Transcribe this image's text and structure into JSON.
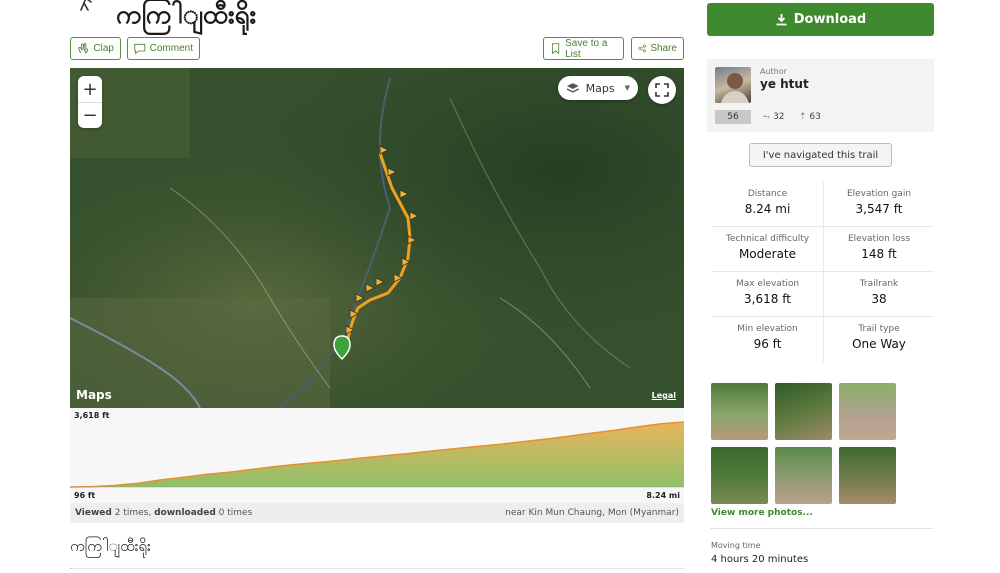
{
  "page": {
    "title": "ကကြါျထီးရိုး",
    "subtitle": "ကကြါျထီးရိုး"
  },
  "actions": {
    "clap": "Clap",
    "comment": "Comment",
    "save": "Save to a List",
    "share": "Share"
  },
  "map": {
    "layer_label": "Maps",
    "zoom_in": "+",
    "zoom_out": "−",
    "logo": "Maps",
    "legal": "Legal"
  },
  "elevation": {
    "max": "3,618 ft",
    "min": "96 ft",
    "distance": "8.24 mi",
    "profile": [
      96,
      120,
      180,
      300,
      480,
      620,
      780,
      900,
      1050,
      1200,
      1330,
      1440,
      1560,
      1690,
      1810,
      1930,
      2060,
      2180,
      2300,
      2420,
      2560,
      2700,
      2860,
      3020,
      3180,
      3360,
      3520,
      3618
    ]
  },
  "usage": {
    "viewed_label": "Viewed",
    "viewed_text": "2 times,",
    "downloaded_label": "downloaded",
    "downloaded_text": "0 times",
    "location": "near Kin Mun Chaung, Mon (Myanmar)"
  },
  "download": {
    "label": "Download"
  },
  "author": {
    "label": "Author",
    "name": "ye htut",
    "badge": "56",
    "trails_count": "32",
    "followers_count": "63"
  },
  "navigated_button": "I've navigated this trail",
  "stats": [
    {
      "label": "Distance",
      "value": "8.24 mi"
    },
    {
      "label": "Elevation gain",
      "value": "3,547 ft"
    },
    {
      "label": "Technical difficulty",
      "value": "Moderate"
    },
    {
      "label": "Elevation loss",
      "value": "148 ft"
    },
    {
      "label": "Max elevation",
      "value": "3,618 ft"
    },
    {
      "label": "Trailrank",
      "value": "38"
    },
    {
      "label": "Min elevation",
      "value": "96 ft"
    },
    {
      "label": "Trail type",
      "value": "One Way"
    }
  ],
  "photos_link": "View more photos...",
  "moving_time": {
    "label": "Moving time",
    "value": "4 hours 20 minutes"
  },
  "colors": {
    "brand_green": "#3f8a2e",
    "track_orange": "#f0a020"
  }
}
